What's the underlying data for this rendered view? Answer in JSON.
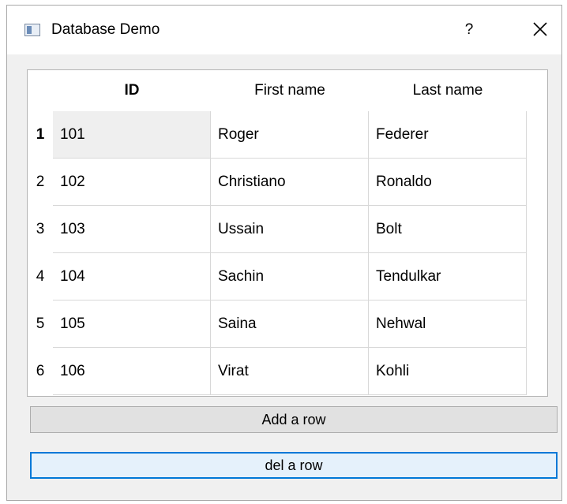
{
  "window": {
    "title": "Database Demo",
    "help_glyph": "?",
    "icons": {
      "app": "app-window-icon",
      "close": "close-icon"
    }
  },
  "table": {
    "columns": [
      "ID",
      "First name",
      "Last name"
    ],
    "row_headers": [
      "1",
      "2",
      "3",
      "4",
      "5",
      "6"
    ],
    "rows": [
      [
        "101",
        "Roger",
        "Federer"
      ],
      [
        "102",
        "Christiano",
        "Ronaldo"
      ],
      [
        "103",
        "Ussain",
        "Bolt"
      ],
      [
        "104",
        "Sachin",
        "Tendulkar"
      ],
      [
        "105",
        "Saina",
        "Nehwal"
      ],
      [
        "106",
        "Virat",
        "Kohli"
      ]
    ],
    "current_cell": {
      "row": 1,
      "column": "ID"
    }
  },
  "buttons": {
    "add_label": "Add a row",
    "del_label": "del a row"
  },
  "colors": {
    "focus_border": "#0078d7",
    "button_face": "#e1e1e1",
    "selected_cell": "#efefef"
  }
}
